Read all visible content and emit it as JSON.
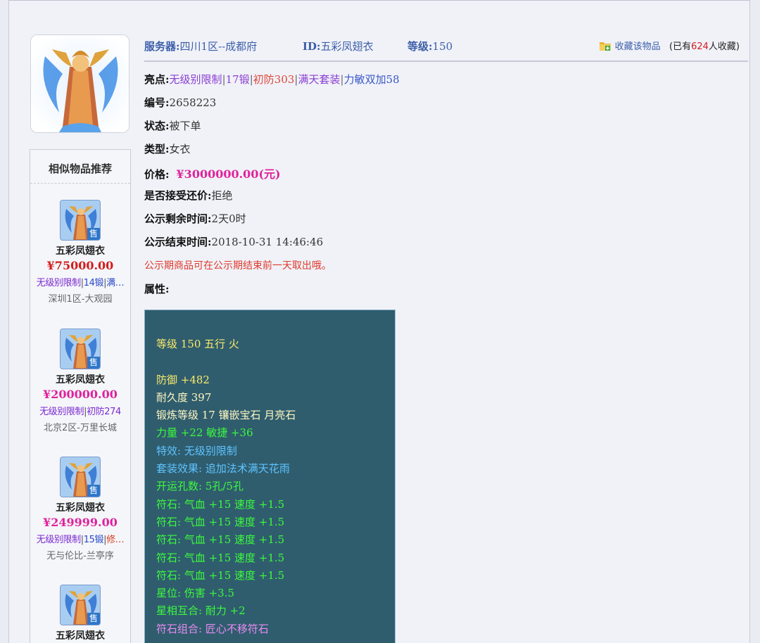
{
  "header": {
    "server_label": "服务器:",
    "server_value": "四川1区--成都府",
    "id_label": "ID:",
    "id_value": "五彩凤翅衣",
    "level_label": "等级:",
    "level_value": "150",
    "favorite_link": "收藏该物品",
    "favorite_prefix": "(已有",
    "favorite_count": "624",
    "favorite_suffix": "人收藏)"
  },
  "details": {
    "highlights_label": "亮点:",
    "highlights": [
      {
        "text": "无级别限制",
        "color": "purple"
      },
      {
        "text": "17锻",
        "color": "purple"
      },
      {
        "text": "初防303",
        "color": "red"
      },
      {
        "text": "满天套装",
        "color": "purple"
      },
      {
        "text": "力敏双加58",
        "color": "blue"
      }
    ],
    "serial_label": "编号:",
    "serial_value": "2658223",
    "status_label": "状态:",
    "status_value": "被下单",
    "type_label": "类型:",
    "type_value": "女衣",
    "price_label": "价格:",
    "price_value": "¥3000000.00(元)",
    "bargain_label": "是否接受还价:",
    "bargain_value": "拒绝",
    "remaining_label": "公示剩余时间:",
    "remaining_value": "2天0时",
    "end_label": "公示结束时间:",
    "end_value": "2018-10-31 14:46:46",
    "notice": "公示期商品可在公示期结束前一天取出哦。",
    "attributes_label": "属性:"
  },
  "attributes": [
    {
      "text": "等级 150 五行 火",
      "color": "yellow"
    },
    {
      "text": "",
      "color": "blank"
    },
    {
      "text": "防御 +482",
      "color": "yellow"
    },
    {
      "text": "耐久度 397",
      "color": "white"
    },
    {
      "text": "锻炼等级 17 镶嵌宝石 月亮石",
      "color": "white"
    },
    {
      "text": "力量 +22 敏捷 +36",
      "color": "green"
    },
    {
      "text": "特效: 无级别限制",
      "color": "cyan"
    },
    {
      "text": "套装效果: 追加法术满天花雨",
      "color": "cyan"
    },
    {
      "text": "开运孔数: 5孔/5孔",
      "color": "green"
    },
    {
      "text": "符石: 气血 +15 速度 +1.5",
      "color": "green"
    },
    {
      "text": "符石: 气血 +15 速度 +1.5",
      "color": "green"
    },
    {
      "text": "符石: 气血 +15 速度 +1.5",
      "color": "green"
    },
    {
      "text": "符石: 气血 +15 速度 +1.5",
      "color": "green"
    },
    {
      "text": "符石: 气血 +15 速度 +1.5",
      "color": "green"
    },
    {
      "text": "星位: 伤害 +3.5",
      "color": "green"
    },
    {
      "text": "星相互合: 耐力 +2",
      "color": "green"
    },
    {
      "text": "符石组合: 匠心不移符石",
      "color": "purple"
    }
  ],
  "similar": {
    "title": "相似物品推荐",
    "sale_badge": "售",
    "items": [
      {
        "name": "五彩凤翅衣",
        "price": "¥75000.00",
        "price_color": "red",
        "tags": [
          {
            "text": "无级别限制",
            "color": "purple"
          },
          {
            "text": "14锻",
            "color": "blue"
          },
          {
            "text": "满…",
            "color": "blue"
          }
        ],
        "server": "深圳1区-大观园"
      },
      {
        "name": "五彩凤翅衣",
        "price": "¥200000.00",
        "price_color": "pink",
        "tags": [
          {
            "text": "无级别限制",
            "color": "purple"
          },
          {
            "text": "初防274",
            "color": "purple"
          }
        ],
        "server": "北京2区-万里长城"
      },
      {
        "name": "五彩凤翅衣",
        "price": "¥249999.00",
        "price_color": "pink",
        "tags": [
          {
            "text": "无级别限制",
            "color": "purple"
          },
          {
            "text": "15锻",
            "color": "blue"
          },
          {
            "text": "修…",
            "color": "red"
          }
        ],
        "server": "无与伦比-兰亭序"
      },
      {
        "name": "五彩凤翅衣",
        "price": "",
        "price_color": "pink",
        "tags": [],
        "server": ""
      }
    ]
  },
  "colors": {
    "accent_blue": "#3c5ea8",
    "price_pink": "#e0229b",
    "price_red": "#d21c1c",
    "attr_background": "#2f5d6e"
  },
  "icons": {
    "item_portrait": "phoenix-robe-icon",
    "favorite": "folder-add-icon"
  }
}
